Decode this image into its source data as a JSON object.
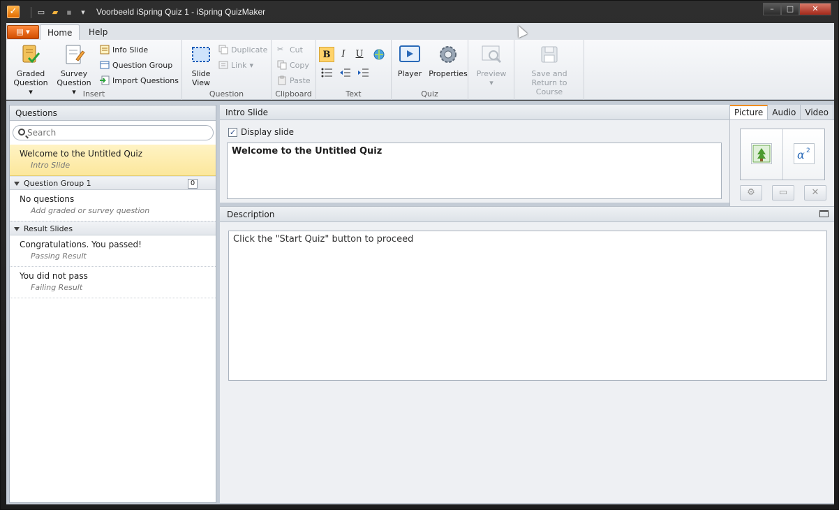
{
  "window": {
    "title": "Voorbeeld iSpring Quiz 1 - iSpring QuizMaker",
    "minimize": "–",
    "maximize": "□",
    "close": "✕"
  },
  "ribbon": {
    "tabs": [
      "Home",
      "Help"
    ],
    "active_tab": "Home",
    "groups": {
      "insert": {
        "label": "Insert",
        "graded_question": "Graded Question",
        "survey_question": "Survey Question",
        "info_slide": "Info Slide",
        "question_group": "Question Group",
        "import_questions": "Import Questions"
      },
      "question": {
        "label": "Question",
        "slide_view": "Slide View",
        "duplicate": "Duplicate",
        "link": "Link"
      },
      "clipboard": {
        "label": "Clipboard",
        "cut": "Cut",
        "copy": "Copy",
        "paste": "Paste"
      },
      "text": {
        "label": "Text",
        "bold": "B",
        "italic": "I",
        "underline": "U"
      },
      "quiz": {
        "label": "Quiz",
        "player": "Player",
        "properties": "Properties"
      },
      "preview": {
        "label": "Preview"
      },
      "save": {
        "label": "Save and Return to Course"
      }
    }
  },
  "questions_panel": {
    "header": "Questions",
    "search_placeholder": "Search",
    "intro": {
      "title": "Welcome to the Untitled Quiz",
      "subtitle": "Intro Slide"
    },
    "group": {
      "name": "Question Group 1",
      "count": "0"
    },
    "empty": {
      "title": "No questions",
      "subtitle": "Add graded or survey question"
    },
    "result_header": "Result Slides",
    "results": [
      {
        "title": "Congratulations. You passed!",
        "subtitle": "Passing Result"
      },
      {
        "title": "You did not pass",
        "subtitle": "Failing Result"
      }
    ]
  },
  "intro_slide": {
    "header": "Intro Slide",
    "display_slide_label": "Display slide",
    "display_slide_checked": true,
    "title": "Welcome to the Untitled Quiz"
  },
  "media": {
    "tabs": [
      "Picture",
      "Audio",
      "Video"
    ],
    "active_tab": "Picture"
  },
  "description": {
    "header": "Description",
    "text": "Click the \"Start Quiz\" button to proceed"
  },
  "colors": {
    "accent": "#f08c1e",
    "selection": "#fce79c"
  }
}
